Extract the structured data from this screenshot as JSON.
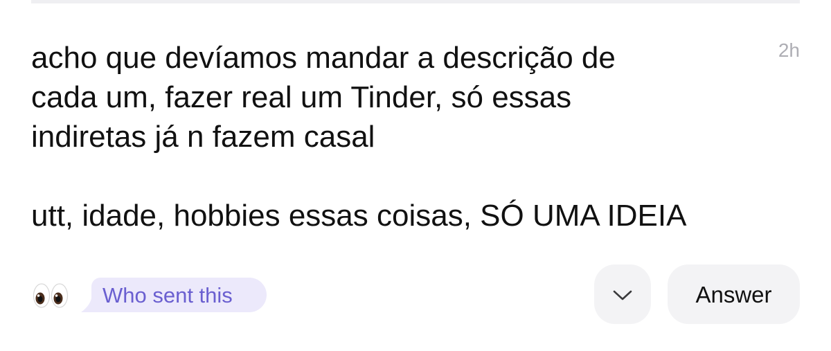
{
  "post": {
    "message": "acho que devíamos mandar a descrição de\ncada um, fazer real um Tinder, só essas\nindiretas já n fazem casal\n\nutt, idade, hobbies essas coisas, SÓ UMA IDEIA",
    "time": "2h"
  },
  "actions": {
    "reaction_icon": "eyes-emoji",
    "who_sent_label": "Who sent this",
    "more_icon": "chevron-down-icon",
    "answer_label": "Answer"
  },
  "colors": {
    "accent_text": "#6a5fd0",
    "accent_bg": "#ece9fb",
    "button_bg": "#f3f3f5",
    "time_text": "#aeaeb4"
  }
}
